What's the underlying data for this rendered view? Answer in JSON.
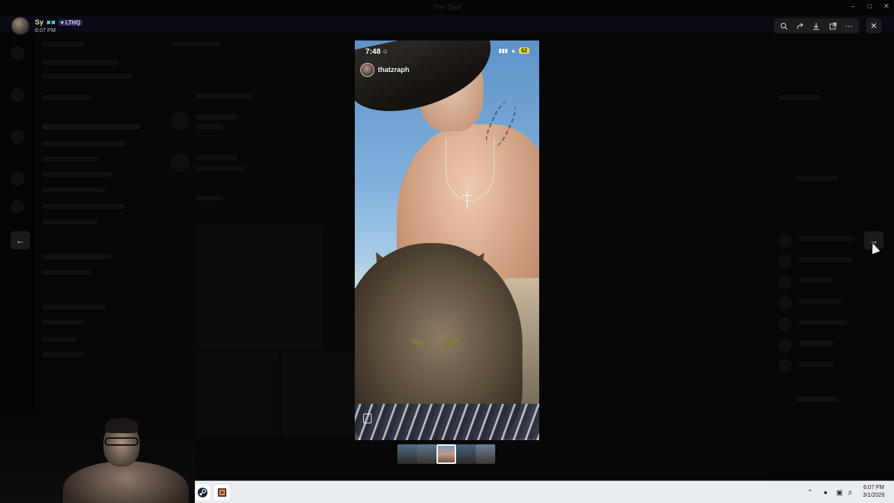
{
  "window": {
    "title": "The Spot"
  },
  "viewer": {
    "uploader": {
      "name": "Sy",
      "tag": "LTHQ",
      "time": "6:07 PM"
    },
    "tools": [
      "zoom-icon",
      "forward-icon",
      "download-icon",
      "open-external-icon",
      "more-icon"
    ],
    "story": {
      "status_time": "7:48",
      "battery": "62",
      "username": "thatzraph"
    },
    "thumbnail_count": 5,
    "active_thumbnail": 3
  },
  "taskbar": {
    "apps": [
      "steam-icon",
      "game-icon"
    ],
    "clock_time": "6:07 PM",
    "clock_date": "3/1/2026"
  },
  "colors": {
    "accent": "#5865f2",
    "taskbar": "#e9ecf0",
    "battery": "#f3e04a"
  }
}
